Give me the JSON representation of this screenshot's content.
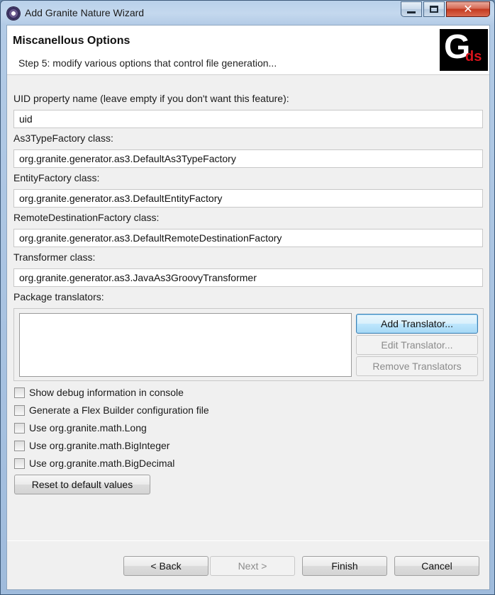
{
  "window": {
    "title": "Add Granite Nature Wizard"
  },
  "banner": {
    "title": "Miscanellous Options",
    "description": "Step 5: modify various options that control file generation...",
    "logo_main": "G",
    "logo_sub": "ds"
  },
  "fields": [
    {
      "label": "UID property name (leave empty if you don't want this feature):",
      "value": "uid"
    },
    {
      "label": "As3TypeFactory class:",
      "value": "org.granite.generator.as3.DefaultAs3TypeFactory"
    },
    {
      "label": "EntityFactory class:",
      "value": "org.granite.generator.as3.DefaultEntityFactory"
    },
    {
      "label": "RemoteDestinationFactory class:",
      "value": "org.granite.generator.as3.DefaultRemoteDestinationFactory"
    },
    {
      "label": "Transformer class:",
      "value": "org.granite.generator.as3.JavaAs3GroovyTransformer"
    }
  ],
  "translators": {
    "label": "Package translators:",
    "add_label": "Add Translator...",
    "edit_label": "Edit Translator...",
    "remove_label": "Remove Translators"
  },
  "options": [
    {
      "label": "Show debug information in console",
      "checked": false
    },
    {
      "label": "Generate a Flex Builder configuration file",
      "checked": false
    },
    {
      "label": "Use org.granite.math.Long",
      "checked": false
    },
    {
      "label": "Use org.granite.math.BigInteger",
      "checked": false
    },
    {
      "label": "Use org.granite.math.BigDecimal",
      "checked": false
    }
  ],
  "reset_label": "Reset to default values",
  "footer": {
    "back_label": "< Back",
    "next_label": "Next >",
    "finish_label": "Finish",
    "cancel_label": "Cancel"
  }
}
